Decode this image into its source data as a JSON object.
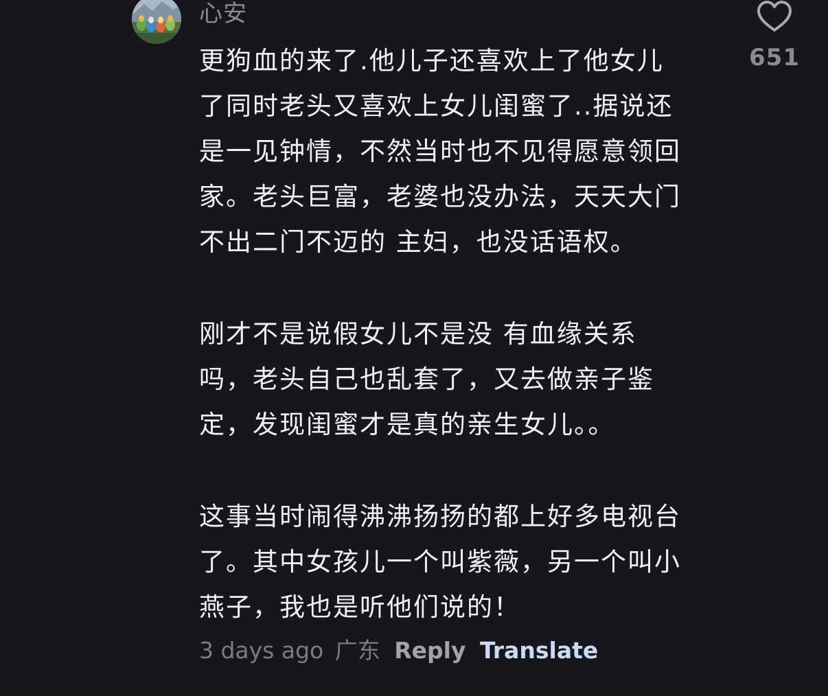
{
  "comment": {
    "username": "心安",
    "avatar": "avatar-icon",
    "paragraphs": [
      {
        "lines": [
          "更狗血的来了.他儿子还喜欢上了他女儿",
          "了同时老头又喜欢上女儿闺蜜了..据说还",
          "是一见钟情，不然当时也不见得愿意领回",
          "家。老头巨富，老婆也没办法，天天大门",
          "不出二门不迈的 主妇，也没话语权。"
        ]
      },
      {
        "lines": [
          "刚才不是说假女儿不是没 有血缘关系",
          "吗，老头自己也乱套了，又去做亲子鉴",
          "定，发现闺蜜才是真的亲生女儿。。"
        ]
      },
      {
        "lines": [
          "这事当时闹得沸沸扬扬的都上好多电视台",
          "了。其中女孩儿一个叫紫薇，另一个叫小",
          "燕子，我也是听他们说的！"
        ]
      }
    ],
    "time": "3 days ago",
    "region": "广东",
    "reply_label": "Reply",
    "translate_label": "Translate",
    "like": {
      "icon": "heart-outline-icon",
      "count": "651"
    }
  },
  "colors": {
    "background": "#17161c",
    "text": "#f2f1f4",
    "muted": "#8b8a90",
    "translate": "#c9dcf4"
  }
}
